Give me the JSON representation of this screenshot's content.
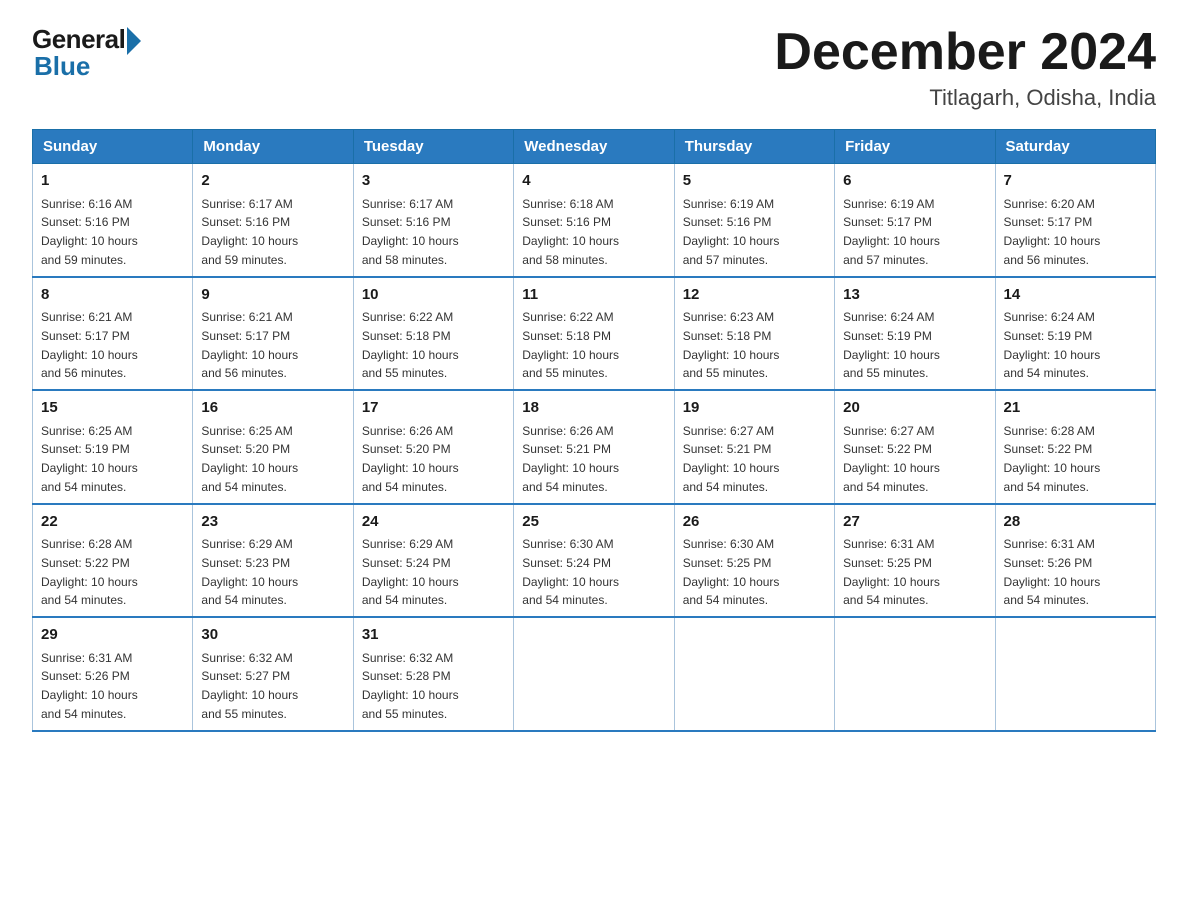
{
  "logo": {
    "general": "General",
    "blue": "Blue"
  },
  "title": "December 2024",
  "location": "Titlagarh, Odisha, India",
  "days_of_week": [
    "Sunday",
    "Monday",
    "Tuesday",
    "Wednesday",
    "Thursday",
    "Friday",
    "Saturday"
  ],
  "weeks": [
    [
      {
        "day": "1",
        "sunrise": "6:16 AM",
        "sunset": "5:16 PM",
        "daylight": "10 hours and 59 minutes."
      },
      {
        "day": "2",
        "sunrise": "6:17 AM",
        "sunset": "5:16 PM",
        "daylight": "10 hours and 59 minutes."
      },
      {
        "day": "3",
        "sunrise": "6:17 AM",
        "sunset": "5:16 PM",
        "daylight": "10 hours and 58 minutes."
      },
      {
        "day": "4",
        "sunrise": "6:18 AM",
        "sunset": "5:16 PM",
        "daylight": "10 hours and 58 minutes."
      },
      {
        "day": "5",
        "sunrise": "6:19 AM",
        "sunset": "5:16 PM",
        "daylight": "10 hours and 57 minutes."
      },
      {
        "day": "6",
        "sunrise": "6:19 AM",
        "sunset": "5:17 PM",
        "daylight": "10 hours and 57 minutes."
      },
      {
        "day": "7",
        "sunrise": "6:20 AM",
        "sunset": "5:17 PM",
        "daylight": "10 hours and 56 minutes."
      }
    ],
    [
      {
        "day": "8",
        "sunrise": "6:21 AM",
        "sunset": "5:17 PM",
        "daylight": "10 hours and 56 minutes."
      },
      {
        "day": "9",
        "sunrise": "6:21 AM",
        "sunset": "5:17 PM",
        "daylight": "10 hours and 56 minutes."
      },
      {
        "day": "10",
        "sunrise": "6:22 AM",
        "sunset": "5:18 PM",
        "daylight": "10 hours and 55 minutes."
      },
      {
        "day": "11",
        "sunrise": "6:22 AM",
        "sunset": "5:18 PM",
        "daylight": "10 hours and 55 minutes."
      },
      {
        "day": "12",
        "sunrise": "6:23 AM",
        "sunset": "5:18 PM",
        "daylight": "10 hours and 55 minutes."
      },
      {
        "day": "13",
        "sunrise": "6:24 AM",
        "sunset": "5:19 PM",
        "daylight": "10 hours and 55 minutes."
      },
      {
        "day": "14",
        "sunrise": "6:24 AM",
        "sunset": "5:19 PM",
        "daylight": "10 hours and 54 minutes."
      }
    ],
    [
      {
        "day": "15",
        "sunrise": "6:25 AM",
        "sunset": "5:19 PM",
        "daylight": "10 hours and 54 minutes."
      },
      {
        "day": "16",
        "sunrise": "6:25 AM",
        "sunset": "5:20 PM",
        "daylight": "10 hours and 54 minutes."
      },
      {
        "day": "17",
        "sunrise": "6:26 AM",
        "sunset": "5:20 PM",
        "daylight": "10 hours and 54 minutes."
      },
      {
        "day": "18",
        "sunrise": "6:26 AM",
        "sunset": "5:21 PM",
        "daylight": "10 hours and 54 minutes."
      },
      {
        "day": "19",
        "sunrise": "6:27 AM",
        "sunset": "5:21 PM",
        "daylight": "10 hours and 54 minutes."
      },
      {
        "day": "20",
        "sunrise": "6:27 AM",
        "sunset": "5:22 PM",
        "daylight": "10 hours and 54 minutes."
      },
      {
        "day": "21",
        "sunrise": "6:28 AM",
        "sunset": "5:22 PM",
        "daylight": "10 hours and 54 minutes."
      }
    ],
    [
      {
        "day": "22",
        "sunrise": "6:28 AM",
        "sunset": "5:22 PM",
        "daylight": "10 hours and 54 minutes."
      },
      {
        "day": "23",
        "sunrise": "6:29 AM",
        "sunset": "5:23 PM",
        "daylight": "10 hours and 54 minutes."
      },
      {
        "day": "24",
        "sunrise": "6:29 AM",
        "sunset": "5:24 PM",
        "daylight": "10 hours and 54 minutes."
      },
      {
        "day": "25",
        "sunrise": "6:30 AM",
        "sunset": "5:24 PM",
        "daylight": "10 hours and 54 minutes."
      },
      {
        "day": "26",
        "sunrise": "6:30 AM",
        "sunset": "5:25 PM",
        "daylight": "10 hours and 54 minutes."
      },
      {
        "day": "27",
        "sunrise": "6:31 AM",
        "sunset": "5:25 PM",
        "daylight": "10 hours and 54 minutes."
      },
      {
        "day": "28",
        "sunrise": "6:31 AM",
        "sunset": "5:26 PM",
        "daylight": "10 hours and 54 minutes."
      }
    ],
    [
      {
        "day": "29",
        "sunrise": "6:31 AM",
        "sunset": "5:26 PM",
        "daylight": "10 hours and 54 minutes."
      },
      {
        "day": "30",
        "sunrise": "6:32 AM",
        "sunset": "5:27 PM",
        "daylight": "10 hours and 55 minutes."
      },
      {
        "day": "31",
        "sunrise": "6:32 AM",
        "sunset": "5:28 PM",
        "daylight": "10 hours and 55 minutes."
      },
      null,
      null,
      null,
      null
    ]
  ],
  "labels": {
    "sunrise": "Sunrise:",
    "sunset": "Sunset:",
    "daylight": "Daylight:"
  }
}
